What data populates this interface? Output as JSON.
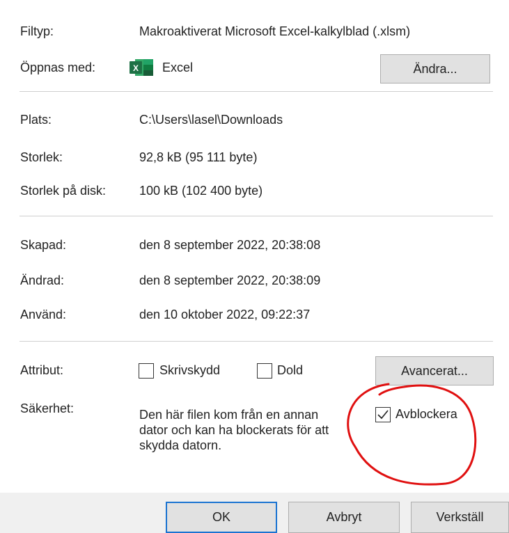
{
  "general": {
    "file_type_label": "Filtyp:",
    "file_type_value": "Makroaktiverat  Microsoft Excel-kalkylblad (.xlsm)",
    "opens_with_label": "Öppnas med:",
    "opens_with_value": "Excel",
    "change_button": "Ändra...",
    "icon": "excel-icon"
  },
  "location": {
    "location_label": "Plats:",
    "location_value": "C:\\Users\\lasel\\Downloads",
    "size_label": "Storlek:",
    "size_value": "92,8 kB (95 111 byte)",
    "size_on_disk_label": "Storlek på disk:",
    "size_on_disk_value": "100 kB (102 400 byte)"
  },
  "dates": {
    "created_label": "Skapad:",
    "created_value": "den 8 september 2022, 20:38:08",
    "modified_label": "Ändrad:",
    "modified_value": "den 8 september 2022, 20:38:09",
    "accessed_label": "Använd:",
    "accessed_value": "den 10 oktober 2022, 09:22:37"
  },
  "attributes": {
    "label": "Attribut:",
    "readonly_label": "Skrivskydd",
    "readonly_checked": false,
    "hidden_label": "Dold",
    "hidden_checked": false,
    "advanced_button": "Avancerat..."
  },
  "security": {
    "label": "Säkerhet:",
    "text_line1": "Den här filen kom från en annan",
    "text_line2": "dator och kan ha blockerats för att",
    "text_line3": "skydda datorn.",
    "unblock_label": "Avblockera",
    "unblock_checked": true
  },
  "footer": {
    "ok_button": "OK",
    "cancel_button": "Avbryt",
    "apply_button": "Verkställ"
  },
  "colors": {
    "annotation": "#e01010",
    "excel_green": "#1e7145",
    "default_button_border": "#1a73d1"
  }
}
